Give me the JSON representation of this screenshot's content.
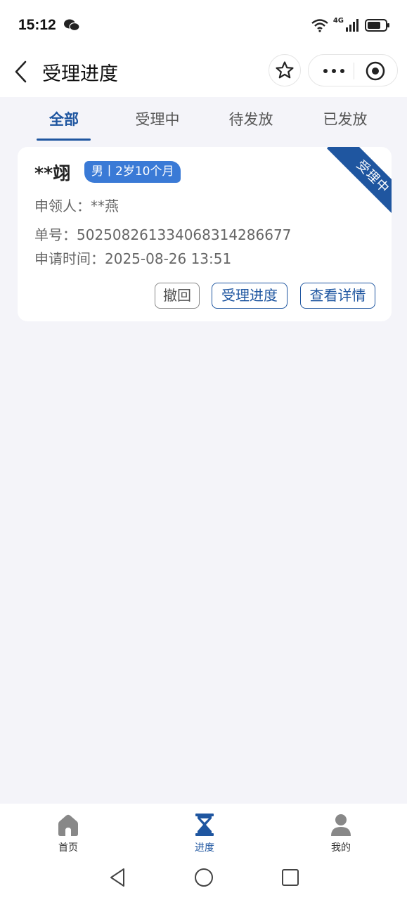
{
  "status_bar": {
    "time": "15:12",
    "network": "4G"
  },
  "header": {
    "title": "受理进度"
  },
  "tabs": [
    {
      "label": "全部",
      "active": true
    },
    {
      "label": "受理中",
      "active": false
    },
    {
      "label": "待发放",
      "active": false
    },
    {
      "label": "已发放",
      "active": false
    }
  ],
  "card": {
    "name": "**翊",
    "tag": "男丨2岁10个月",
    "status_ribbon": "受理中",
    "applicant": "申领人：**燕",
    "order_no": "单号：5025082613340683142866​77",
    "apply_time": "申请时间：2025-08-26 13:51",
    "buttons": {
      "withdraw": "撤回",
      "progress": "受理进度",
      "details": "查看详情"
    }
  },
  "bottom_nav": [
    {
      "label": "首页",
      "icon": "home-icon",
      "active": false
    },
    {
      "label": "进度",
      "icon": "hourglass-icon",
      "active": true
    },
    {
      "label": "我的",
      "icon": "user-icon",
      "active": false
    }
  ],
  "colors": {
    "accent": "#1f56a0",
    "tag": "#3a7ad6",
    "background": "#f4f4f9"
  }
}
